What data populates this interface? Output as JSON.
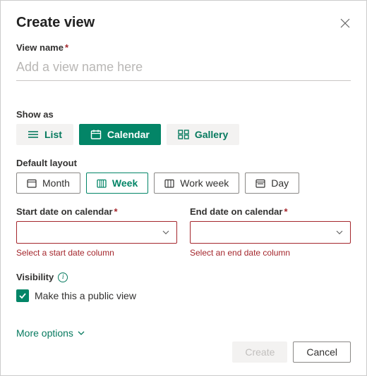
{
  "header": {
    "title": "Create view"
  },
  "viewName": {
    "label": "View name",
    "placeholder": "Add a view name here",
    "value": ""
  },
  "showAs": {
    "label": "Show as",
    "options": {
      "list": "List",
      "calendar": "Calendar",
      "gallery": "Gallery"
    }
  },
  "layout": {
    "label": "Default layout",
    "options": {
      "month": "Month",
      "week": "Week",
      "workweek": "Work week",
      "day": "Day"
    }
  },
  "startDate": {
    "label": "Start date on calendar",
    "error": "Select a start date column"
  },
  "endDate": {
    "label": "End date on calendar",
    "error": "Select an end date column"
  },
  "visibility": {
    "label": "Visibility",
    "checkboxLabel": "Make this a public view"
  },
  "moreOptions": "More options",
  "footer": {
    "create": "Create",
    "cancel": "Cancel"
  }
}
